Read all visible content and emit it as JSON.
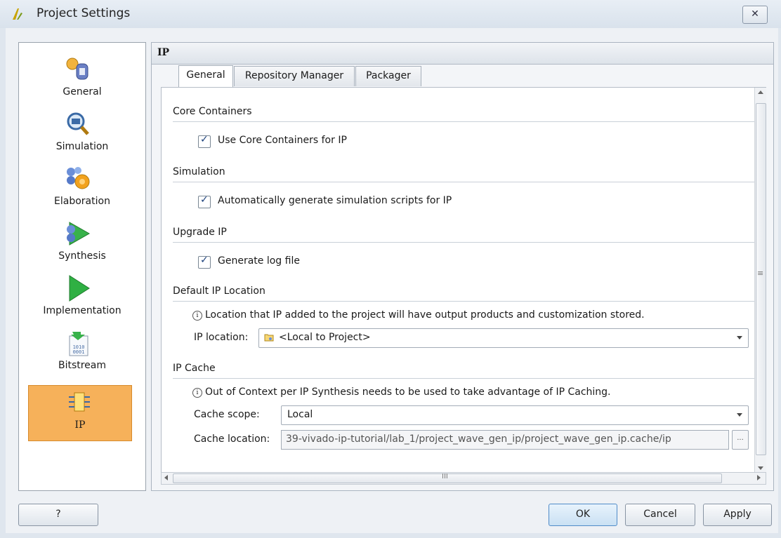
{
  "window": {
    "title": "Project Settings",
    "close_label": "✕"
  },
  "nav": {
    "items": [
      {
        "label": "General",
        "icon": "general-icon"
      },
      {
        "label": "Simulation",
        "icon": "simulation-icon"
      },
      {
        "label": "Elaboration",
        "icon": "elaboration-icon"
      },
      {
        "label": "Synthesis",
        "icon": "synthesis-icon"
      },
      {
        "label": "Implementation",
        "icon": "implementation-icon"
      },
      {
        "label": "Bitstream",
        "icon": "bitstream-icon"
      },
      {
        "label": "IP",
        "icon": "ip-icon",
        "active": true
      }
    ]
  },
  "panel": {
    "header": "IP",
    "tabs": [
      "General",
      "Repository Manager",
      "Packager"
    ],
    "active_tab": "General"
  },
  "sections": {
    "core_containers": {
      "title": "Core Containers",
      "checkbox_label": "Use Core Containers for IP",
      "checked": true
    },
    "simulation": {
      "title": "Simulation",
      "checkbox_label": "Automatically generate simulation scripts for IP",
      "checked": true
    },
    "upgrade_ip": {
      "title": "Upgrade IP",
      "checkbox_label": "Generate log file",
      "checked": true
    },
    "default_ip_location": {
      "title": "Default IP Location",
      "info": "Location that IP added to the project will have output products and customization stored.",
      "field_label": "IP location:",
      "value": "<Local to Project>"
    },
    "ip_cache": {
      "title": "IP Cache",
      "info": "Out of Context per IP Synthesis needs to be used to take advantage of IP Caching.",
      "scope_label": "Cache scope:",
      "scope_value": "Local",
      "location_label": "Cache location:",
      "location_value": "39-vivado-ip-tutorial/lab_1/project_wave_gen_ip/project_wave_gen_ip.cache/ip",
      "browse_label": "..."
    }
  },
  "scrollbar": {
    "h_grip": "III",
    "v_grip": "≡"
  },
  "buttons": {
    "help": "?",
    "ok": "OK",
    "cancel": "Cancel",
    "apply": "Apply"
  },
  "colors": {
    "active_nav": "#f6b15a",
    "accent": "#4f8bc8"
  }
}
